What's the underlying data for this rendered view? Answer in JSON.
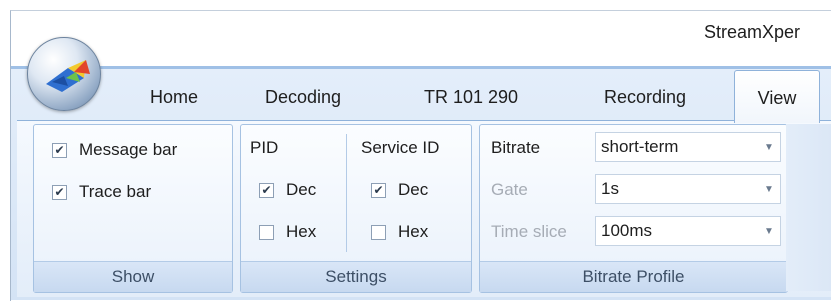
{
  "window": {
    "title": "StreamXper"
  },
  "tabs": [
    {
      "label": "Home"
    },
    {
      "label": "Decoding"
    },
    {
      "label": "TR 101 290"
    },
    {
      "label": "Recording"
    },
    {
      "label": "View"
    }
  ],
  "groups": {
    "show": {
      "label": "Show",
      "message_bar": {
        "label": "Message bar",
        "checked": true
      },
      "trace_bar": {
        "label": "Trace bar",
        "checked": true
      }
    },
    "settings": {
      "label": "Settings",
      "pid": {
        "header": "PID",
        "dec": {
          "label": "Dec",
          "checked": true
        },
        "hex": {
          "label": "Hex",
          "checked": false
        }
      },
      "service_id": {
        "header": "Service ID",
        "dec": {
          "label": "Dec",
          "checked": true
        },
        "hex": {
          "label": "Hex",
          "checked": false
        }
      }
    },
    "bitrate_profile": {
      "label": "Bitrate Profile",
      "bitrate": {
        "label": "Bitrate",
        "value": "short-term"
      },
      "gate": {
        "label": "Gate",
        "value": "1s"
      },
      "time_slice": {
        "label": "Time slice",
        "value": "100ms"
      }
    }
  },
  "icons": {
    "check": "✔",
    "dropdown": "▼"
  },
  "colors": {
    "ribbon_bg": "#dbe7f6",
    "accent_border": "#8fb2da",
    "group_label_text": "#3d4f66"
  }
}
